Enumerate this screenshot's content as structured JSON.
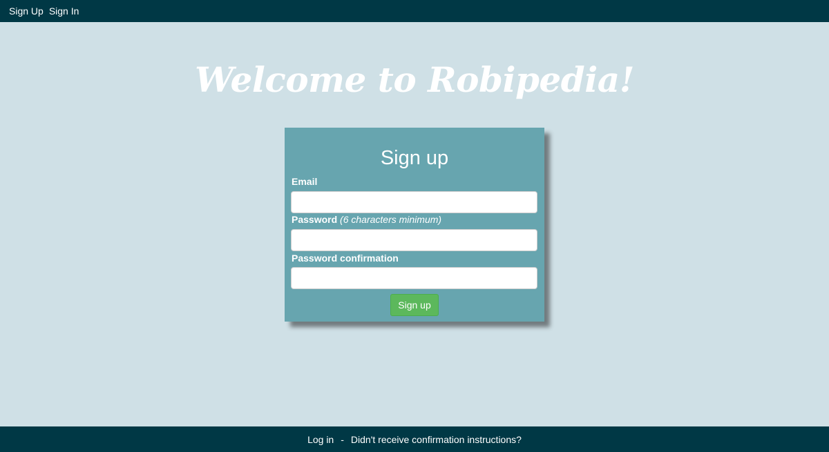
{
  "nav": {
    "sign_up": "Sign Up",
    "sign_in": "Sign In"
  },
  "hero": {
    "title": "Welcome to Robipedia!"
  },
  "form": {
    "title": "Sign up",
    "email_label": "Email",
    "email_value": "",
    "password_label": "Password",
    "password_hint": "(6 characters minimum)",
    "password_value": "",
    "confirm_label": "Password confirmation",
    "confirm_value": "",
    "submit_label": "Sign up"
  },
  "footer": {
    "login": "Log in",
    "separator": "-",
    "confirm_link": "Didn't receive confirmation instructions?"
  },
  "colors": {
    "nav_bg": "#003845",
    "page_bg": "#cfe0e6",
    "card_bg": "#67a5af",
    "button_bg": "#5cb85c"
  }
}
